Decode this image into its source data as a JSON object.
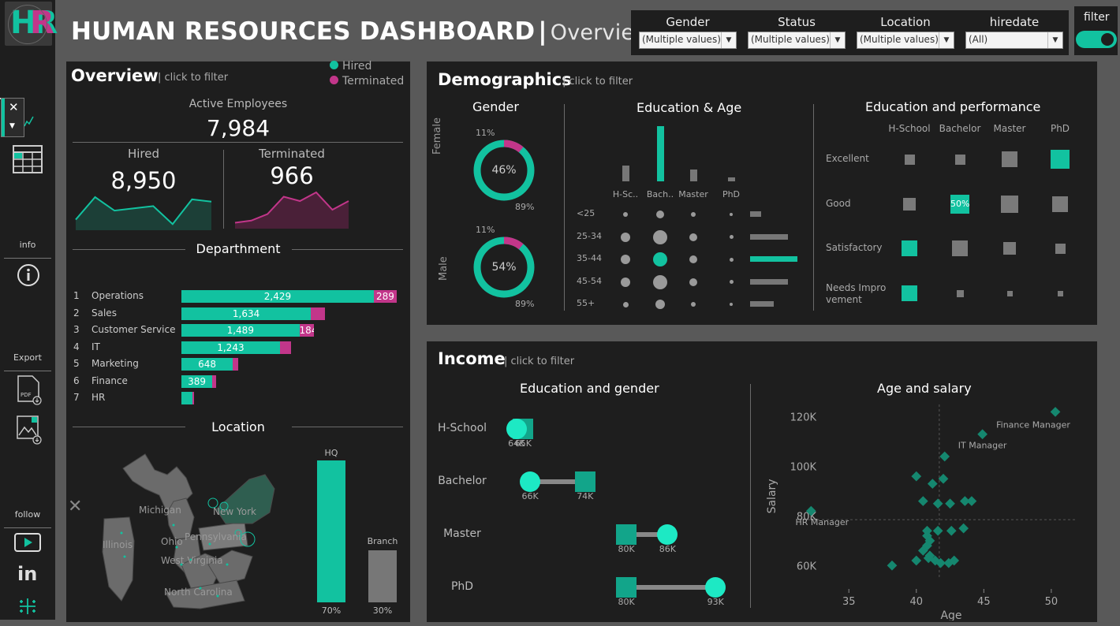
{
  "header": {
    "logo_text": "HR",
    "title": "HUMAN RESOURCES DASHBOARD",
    "separator": "|",
    "subtitle": "Overview"
  },
  "filters": [
    {
      "label": "Gender",
      "value": "(Multiple values)"
    },
    {
      "label": "Status",
      "value": "(Multiple values)"
    },
    {
      "label": "Location",
      "value": "(Multiple values)"
    },
    {
      "label": "hiredate",
      "value": "(All)"
    }
  ],
  "filter_toggle": {
    "label": "filter",
    "state": "on"
  },
  "sidebar": {
    "info_label": "info",
    "export_label": "Export",
    "follow_label": "follow",
    "close_glyph": "✕"
  },
  "colors": {
    "accent": "#12c2a0",
    "terminated": "#c2368a",
    "panel": "#1e1e1e",
    "background": "#595959"
  },
  "overview": {
    "title": "Overview",
    "click_hint": "| click to filter",
    "legend": [
      {
        "label": "Hired",
        "color": "#12c2a0"
      },
      {
        "label": "Terminated",
        "color": "#c2368a"
      }
    ],
    "active_label": "Active Employees",
    "active_value": "7,984",
    "hired_label": "Hired",
    "hired_value": "8,950",
    "terminated_label": "Terminated",
    "terminated_value": "966",
    "hired_trend": [
      2,
      7,
      4,
      4.5,
      5,
      1,
      6.5,
      6
    ],
    "terminated_trend": [
      1,
      1.5,
      3,
      7,
      6,
      8,
      4,
      6
    ]
  },
  "department": {
    "title": "Departhment",
    "rows": [
      {
        "rank": "1",
        "name": "Operations",
        "hired": 2429,
        "hired_label": "2,429",
        "terminated": 289,
        "terminated_label": "289"
      },
      {
        "rank": "2",
        "name": "Sales",
        "hired": 1634,
        "hired_label": "1,634",
        "terminated": 180,
        "terminated_label": ""
      },
      {
        "rank": "3",
        "name": "Customer Service",
        "hired": 1489,
        "hired_label": "1,489",
        "terminated": 184,
        "terminated_label": "184"
      },
      {
        "rank": "4",
        "name": "IT",
        "hired": 1243,
        "hired_label": "1,243",
        "terminated": 140,
        "terminated_label": ""
      },
      {
        "rank": "5",
        "name": "Marketing",
        "hired": 648,
        "hired_label": "648",
        "terminated": 70,
        "terminated_label": ""
      },
      {
        "rank": "6",
        "name": "Finance",
        "hired": 389,
        "hired_label": "389",
        "terminated": 50,
        "terminated_label": ""
      },
      {
        "rank": "7",
        "name": "HR",
        "hired": 140,
        "hired_label": "",
        "terminated": 20,
        "terminated_label": ""
      }
    ]
  },
  "location": {
    "title": "Location",
    "map_labels": [
      "Michigan",
      "New York",
      "Illinois",
      "Ohio",
      "Pennsylvania",
      "West Virginia",
      "North Carolina"
    ],
    "hq_label": "HQ",
    "hq_pct": "70%",
    "hq_value": 70,
    "branch_label": "Branch",
    "branch_pct": "30%",
    "branch_value": 30
  },
  "demographics": {
    "title": "Demographics",
    "click_hint": "| click to filter",
    "gender": {
      "title": "Gender",
      "female": {
        "label": "Female",
        "pct": "46%",
        "top": "11%",
        "bottom": "89%",
        "term_frac": 0.11
      },
      "male": {
        "label": "Male",
        "pct": "54%",
        "top": "11%",
        "bottom": "89%",
        "term_frac": 0.11
      }
    },
    "edu_age": {
      "title": "Education & Age",
      "edu_labels": [
        "H-Sc..",
        "Bach..",
        "Master",
        "PhD"
      ],
      "edu_values": [
        2,
        7,
        1.5,
        0.5
      ],
      "age_labels": [
        "<25",
        "25-34",
        "35-44",
        "45-54",
        "55+"
      ],
      "age_values": [
        1.2,
        4,
        5,
        4,
        2.5
      ],
      "highlight_edu": 1,
      "highlight_age": 2
    },
    "edu_perf": {
      "title": "Education and performance",
      "columns": [
        "H-School",
        "Bachelor",
        "Master",
        "PhD"
      ],
      "rows": [
        "Excellent",
        "Good",
        "Satisfactory",
        "Needs Impro vement"
      ],
      "highlight_label": "50%"
    }
  },
  "income": {
    "title": "Income",
    "click_hint": "| click to filter",
    "edu_gender": {
      "title": "Education and gender",
      "rows": [
        {
          "label": "H-School",
          "female": 64,
          "male": 65,
          "female_label": "64K",
          "male_label": "65K"
        },
        {
          "label": "Bachelor",
          "female": 66,
          "male": 74,
          "female_label": "66K",
          "male_label": "74K"
        },
        {
          "label": "Master",
          "female": 86,
          "male": 80,
          "female_label": "86K",
          "male_label": "80K"
        },
        {
          "label": "PhD",
          "female": 93,
          "male": 80,
          "female_label": "93K",
          "male_label": "80K"
        }
      ]
    },
    "age_salary": {
      "title": "Age and salary",
      "xlabel": "Age",
      "ylabel": "Salary",
      "x_ticks": [
        "35",
        "40",
        "45",
        "50"
      ],
      "y_ticks": [
        "120K",
        "100K",
        "80K",
        "60K"
      ],
      "annotations": [
        "Finance Manager",
        "IT Manager",
        "HR Manager"
      ]
    }
  },
  "chart_data": {
    "type": "scatter",
    "title": "Age and salary",
    "xlabel": "Age",
    "ylabel": "Salary",
    "xlim": [
      33,
      51
    ],
    "ylim": [
      55000,
      125000
    ],
    "points": [
      {
        "x": 50.3,
        "y": 122000,
        "label": "Finance Manager"
      },
      {
        "x": 44.9,
        "y": 113000,
        "label": "IT Manager"
      },
      {
        "x": 32.2,
        "y": 82000,
        "label": "HR Manager"
      },
      {
        "x": 42.1,
        "y": 104000
      },
      {
        "x": 40.0,
        "y": 96000
      },
      {
        "x": 41.2,
        "y": 93000
      },
      {
        "x": 42.0,
        "y": 95000
      },
      {
        "x": 40.5,
        "y": 86000
      },
      {
        "x": 41.6,
        "y": 85000
      },
      {
        "x": 42.5,
        "y": 85000
      },
      {
        "x": 43.6,
        "y": 86000
      },
      {
        "x": 44.1,
        "y": 86000
      },
      {
        "x": 40.8,
        "y": 74000
      },
      {
        "x": 41.6,
        "y": 74000
      },
      {
        "x": 42.6,
        "y": 74000
      },
      {
        "x": 43.5,
        "y": 75000
      },
      {
        "x": 40.8,
        "y": 72000
      },
      {
        "x": 41.0,
        "y": 70000
      },
      {
        "x": 40.8,
        "y": 68000
      },
      {
        "x": 40.5,
        "y": 66000
      },
      {
        "x": 40.0,
        "y": 62000
      },
      {
        "x": 40.9,
        "y": 63000
      },
      {
        "x": 41.4,
        "y": 62000
      },
      {
        "x": 41.8,
        "y": 61000
      },
      {
        "x": 42.4,
        "y": 61000
      },
      {
        "x": 42.8,
        "y": 62000
      },
      {
        "x": 38.2,
        "y": 60000
      },
      {
        "x": 41.0,
        "y": 64000
      }
    ],
    "reference_x": 41.7,
    "reference_y": 78500
  }
}
